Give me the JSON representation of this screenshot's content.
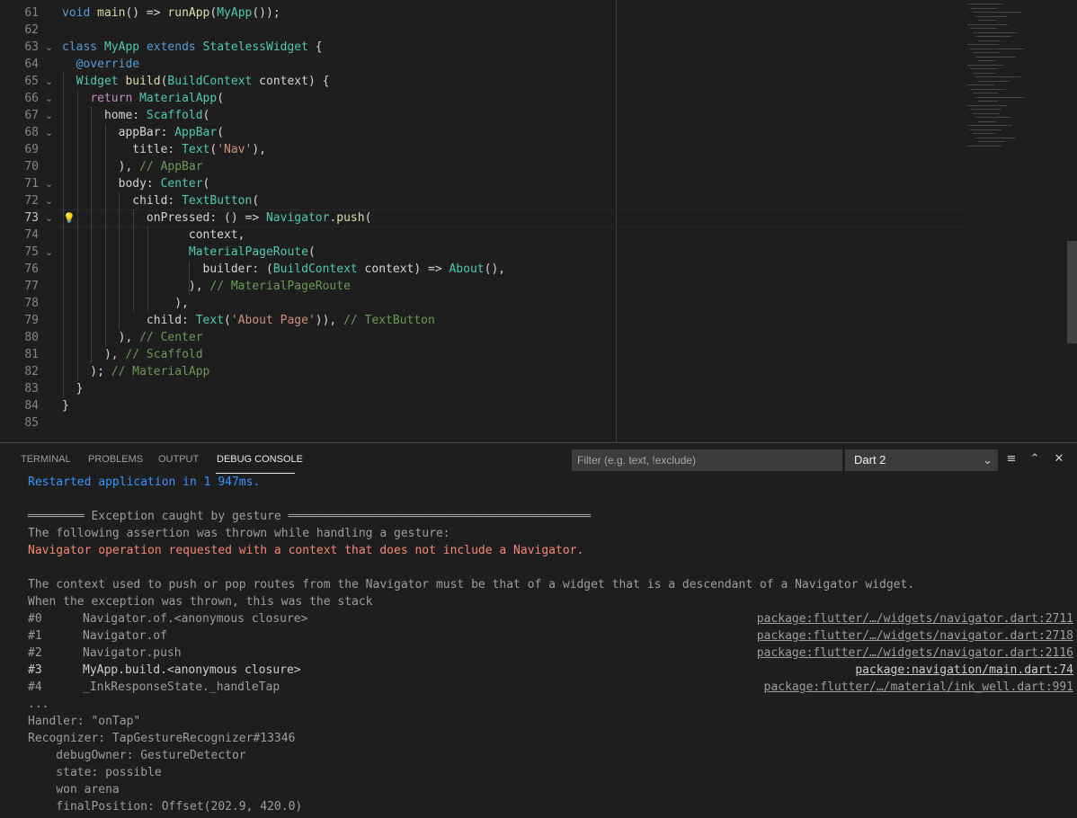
{
  "editor": {
    "lines": [
      {
        "num": "61",
        "fold": "",
        "segs": [
          [
            "k",
            "void"
          ],
          [
            "d",
            " "
          ],
          [
            "f",
            "main"
          ],
          [
            "d",
            "() => "
          ],
          [
            "f",
            "runApp"
          ],
          [
            "d",
            "("
          ],
          [
            "t",
            "MyApp"
          ],
          [
            "d",
            "());"
          ]
        ]
      },
      {
        "num": "62",
        "fold": "",
        "segs": []
      },
      {
        "num": "63",
        "fold": "chevron-down",
        "segs": [
          [
            "k",
            "class"
          ],
          [
            "d",
            " "
          ],
          [
            "t",
            "MyApp"
          ],
          [
            "d",
            " "
          ],
          [
            "k",
            "extends"
          ],
          [
            "d",
            " "
          ],
          [
            "t",
            "StatelessWidget"
          ],
          [
            "d",
            " {"
          ]
        ]
      },
      {
        "num": "64",
        "fold": "",
        "segs": [
          [
            "d",
            "  "
          ],
          [
            "k",
            "@override"
          ]
        ]
      },
      {
        "num": "65",
        "fold": "chevron-down",
        "segs": [
          [
            "d",
            "  "
          ],
          [
            "t",
            "Widget"
          ],
          [
            "d",
            " "
          ],
          [
            "f",
            "build"
          ],
          [
            "d",
            "("
          ],
          [
            "t",
            "BuildContext"
          ],
          [
            "d",
            " context) {"
          ]
        ]
      },
      {
        "num": "66",
        "fold": "chevron-down",
        "segs": [
          [
            "d",
            "    "
          ],
          [
            "c",
            "return"
          ],
          [
            "d",
            " "
          ],
          [
            "t",
            "MaterialApp"
          ],
          [
            "d",
            "("
          ]
        ]
      },
      {
        "num": "67",
        "fold": "chevron-down",
        "segs": [
          [
            "d",
            "      home: "
          ],
          [
            "t",
            "Scaffold"
          ],
          [
            "d",
            "("
          ]
        ]
      },
      {
        "num": "68",
        "fold": "chevron-down",
        "segs": [
          [
            "d",
            "        appBar: "
          ],
          [
            "t",
            "AppBar"
          ],
          [
            "d",
            "("
          ]
        ]
      },
      {
        "num": "69",
        "fold": "",
        "segs": [
          [
            "d",
            "          title: "
          ],
          [
            "t",
            "Text"
          ],
          [
            "d",
            "("
          ],
          [
            "s",
            "'Nav'"
          ],
          [
            "d",
            "),"
          ]
        ]
      },
      {
        "num": "70",
        "fold": "",
        "segs": [
          [
            "d",
            "        ), "
          ],
          [
            "cm",
            "// AppBar"
          ]
        ]
      },
      {
        "num": "71",
        "fold": "chevron-down",
        "segs": [
          [
            "d",
            "        body: "
          ],
          [
            "t",
            "Center"
          ],
          [
            "d",
            "("
          ]
        ]
      },
      {
        "num": "72",
        "fold": "chevron-down",
        "segs": [
          [
            "d",
            "          child: "
          ],
          [
            "t",
            "TextButton"
          ],
          [
            "d",
            "("
          ]
        ]
      },
      {
        "num": "73",
        "fold": "chevron-down",
        "bulb": true,
        "current": true,
        "segs": [
          [
            "d",
            "            onPressed: () => "
          ],
          [
            "t",
            "Navigator"
          ],
          [
            "d",
            "."
          ],
          [
            "f",
            "push"
          ],
          [
            "d",
            "("
          ]
        ]
      },
      {
        "num": "74",
        "fold": "",
        "segs": [
          [
            "d",
            "                  context,"
          ]
        ]
      },
      {
        "num": "75",
        "fold": "chevron-down",
        "segs": [
          [
            "d",
            "                  "
          ],
          [
            "t",
            "MaterialPageRoute"
          ],
          [
            "d",
            "("
          ]
        ]
      },
      {
        "num": "76",
        "fold": "",
        "segs": [
          [
            "d",
            "                    builder: ("
          ],
          [
            "t",
            "BuildContext"
          ],
          [
            "d",
            " context) => "
          ],
          [
            "t",
            "About"
          ],
          [
            "d",
            "(),"
          ]
        ]
      },
      {
        "num": "77",
        "fold": "",
        "segs": [
          [
            "d",
            "                  ), "
          ],
          [
            "cm",
            "// MaterialPageRoute"
          ]
        ]
      },
      {
        "num": "78",
        "fold": "",
        "segs": [
          [
            "d",
            "                ),"
          ]
        ]
      },
      {
        "num": "79",
        "fold": "",
        "segs": [
          [
            "d",
            "            child: "
          ],
          [
            "t",
            "Text"
          ],
          [
            "d",
            "("
          ],
          [
            "s",
            "'About Page'"
          ],
          [
            "d",
            ")), "
          ],
          [
            "cm",
            "// TextButton"
          ]
        ]
      },
      {
        "num": "80",
        "fold": "",
        "segs": [
          [
            "d",
            "        ), "
          ],
          [
            "cm",
            "// Center"
          ]
        ]
      },
      {
        "num": "81",
        "fold": "",
        "segs": [
          [
            "d",
            "      ), "
          ],
          [
            "cm",
            "// Scaffold"
          ]
        ]
      },
      {
        "num": "82",
        "fold": "",
        "segs": [
          [
            "d",
            "    ); "
          ],
          [
            "cm",
            "// MaterialApp"
          ]
        ]
      },
      {
        "num": "83",
        "fold": "",
        "segs": [
          [
            "d",
            "  }"
          ]
        ]
      },
      {
        "num": "84",
        "fold": "",
        "segs": [
          [
            "d",
            "}"
          ]
        ]
      },
      {
        "num": "85",
        "fold": "",
        "segs": []
      }
    ]
  },
  "panel": {
    "tabs": [
      "TERMINAL",
      "PROBLEMS",
      "OUTPUT",
      "DEBUG CONSOLE"
    ],
    "active_tab": "DEBUG CONSOLE",
    "filter_placeholder": "Filter (e.g. text, !exclude)",
    "session_select": "Dart 2"
  },
  "console": {
    "restarted": "Restarted application in 1 947ms.",
    "exception_header": "════════ Exception caught by gesture ═══════════════════════════════════════════",
    "assertion_line": "The following assertion was thrown while handling a gesture:",
    "error_message": "Navigator operation requested with a context that does not include a Navigator.",
    "context_explanation": "The context used to push or pop routes from the Navigator must be that of a widget that is a descendant of a Navigator widget.",
    "stack_intro": "When the exception was thrown, this was the stack",
    "stack": [
      {
        "num": "#0",
        "symbol": "Navigator.of.<anonymous closure>",
        "link": "package:flutter/…/widgets/navigator.dart:2711",
        "highlight": false
      },
      {
        "num": "#1",
        "symbol": "Navigator.of",
        "link": "package:flutter/…/widgets/navigator.dart:2718",
        "highlight": false
      },
      {
        "num": "#2",
        "symbol": "Navigator.push",
        "link": "package:flutter/…/widgets/navigator.dart:2116",
        "highlight": false
      },
      {
        "num": "#3",
        "symbol": "MyApp.build.<anonymous closure>",
        "link": "package:navigation/main.dart:74",
        "highlight": true
      },
      {
        "num": "#4",
        "symbol": "_InkResponseState._handleTap",
        "link": "package:flutter/…/material/ink_well.dart:991",
        "highlight": false
      }
    ],
    "ellipsis": "...",
    "handler": "Handler: \"onTap\"",
    "recognizer": "Recognizer: TapGestureRecognizer#13346",
    "details": [
      "    debugOwner: GestureDetector",
      "    state: possible",
      "    won arena",
      "    finalPosition: Offset(202.9, 420.0)"
    ]
  }
}
